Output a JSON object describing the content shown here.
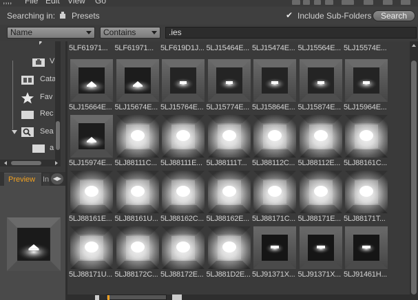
{
  "menubar": {
    "items": [
      "File",
      "Edit",
      "View",
      "Go"
    ]
  },
  "search": {
    "label": "Searching in:",
    "location": "Presets",
    "include_subfolders_label": "Include Sub-Folders",
    "include_subfolders_checked": true,
    "check_glyph": "✔",
    "search_button": "Search"
  },
  "filter": {
    "field": "Name",
    "operator": "Contains",
    "value": ".ies"
  },
  "tree": {
    "items": [
      {
        "label": "V",
        "icon": "folder-icon"
      },
      {
        "label": "Cata",
        "icon": "catalog-icon"
      },
      {
        "label": "Fav",
        "icon": "star-icon"
      },
      {
        "label": "Rec",
        "icon": "folder-icon"
      },
      {
        "label": "Sea",
        "icon": "search-icon"
      },
      {
        "label": "a",
        "icon": "folder-icon"
      }
    ]
  },
  "preview": {
    "tab_label": "Preview",
    "other_tab": "In",
    "nav_glyph": "◀▶"
  },
  "files": {
    "top_row": [
      "5LF61971...",
      "5LF61971...",
      "5LF619D1J...",
      "5LJ15464E...",
      "5LJ15474E...",
      "5LJ15564E...",
      "5LJ15574E..."
    ],
    "rows": [
      {
        "names": [
          "5LJ15664E...",
          "5LJ15674E...",
          "5LJ15764E...",
          "5LJ15774E...",
          "5LJ15864E...",
          "5LJ15874E...",
          "5LJ15964E..."
        ],
        "styles": [
          "wide",
          "wide",
          "box",
          "box",
          "box",
          "box",
          "box"
        ]
      },
      {
        "names": [
          "5LJ15974E...",
          "5LJ88111C...",
          "5LJ88111E...",
          "5LJ88111T...",
          "5LJ88112C...",
          "5LJ88112E...",
          "5LJ88161C..."
        ],
        "styles": [
          "wide",
          "bright",
          "bright",
          "bright",
          "bright",
          "bright",
          "bright"
        ]
      },
      {
        "names": [
          "5LJ88161E...",
          "5LJ88161U...",
          "5LJ88162C...",
          "5LJ88162E...",
          "5LJ88171C...",
          "5LJ88171E...",
          "5LJ88171T..."
        ],
        "styles": [
          "bright",
          "bright",
          "bright",
          "bright",
          "bright",
          "bright",
          "bright"
        ]
      },
      {
        "names": [
          "5LJ88171U...",
          "5LJ88172C...",
          "5LJ88172E...",
          "5LJ881D2E...",
          "5LJ91371X...",
          "5LJ91371X...",
          "5LJ91461H..."
        ],
        "styles": [
          "bright",
          "bright",
          "bright",
          "bright",
          "dark",
          "dark",
          "dark"
        ]
      }
    ]
  }
}
